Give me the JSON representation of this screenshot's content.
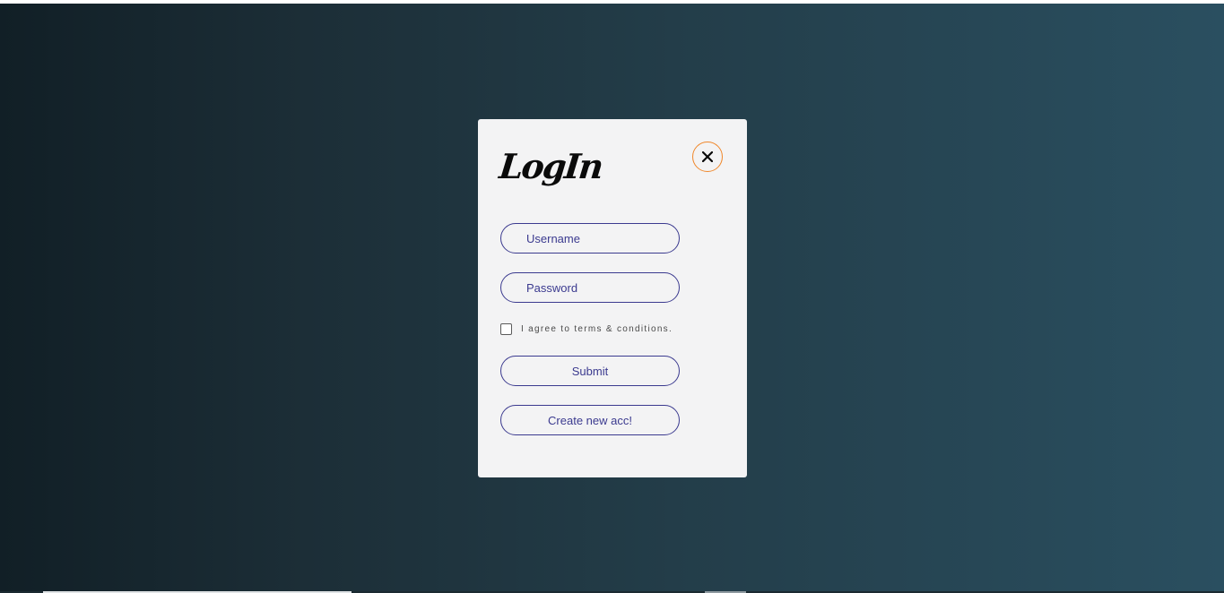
{
  "login_modal": {
    "title": "LogIn",
    "close_icon": "close-x-icon",
    "username_placeholder": "Username",
    "password_placeholder": "Password",
    "terms_label": "I agree to terms & conditions.",
    "submit_label": "Submit",
    "create_account_label": "Create new acc!"
  },
  "colors": {
    "background_gradient_start": "#111f26",
    "background_gradient_end": "#2a4f60",
    "modal_background": "#f3f3f4",
    "accent_border": "#3b3a8f",
    "close_border": "#f0872a"
  }
}
